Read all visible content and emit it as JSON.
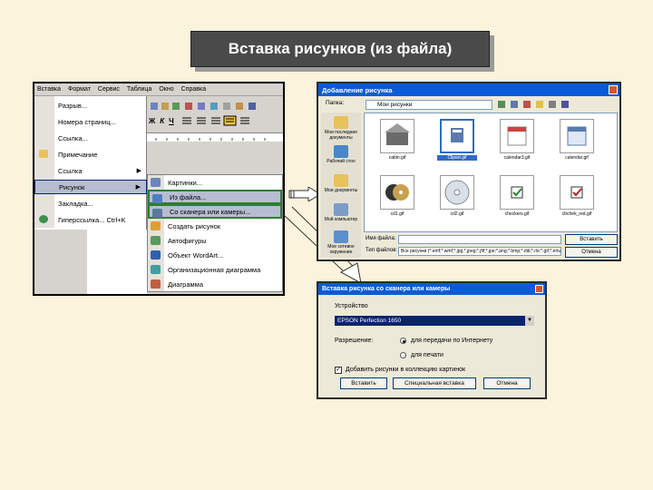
{
  "slide": {
    "title": "Вставка рисунков (из файла)"
  },
  "word": {
    "menubar": [
      "Вставка",
      "Формат",
      "Сервис",
      "Таблица",
      "Окно",
      "Справка"
    ],
    "insert_menu": [
      {
        "label": "Разрыв...",
        "icon": "none"
      },
      {
        "label": "Номера страниц...",
        "icon": "none"
      },
      {
        "label": "Ссылка...",
        "icon": "none"
      },
      {
        "label": "Примечание",
        "icon": "note-icon"
      },
      {
        "label": "Ссылка",
        "icon": "none",
        "submenu": true
      },
      {
        "label": "Рисунок",
        "icon": "none",
        "submenu": true,
        "highlighted": true
      },
      {
        "label": "Закладка...",
        "icon": "none"
      },
      {
        "label": "Гиперссылка...  Ctrl+K",
        "icon": "hyperlink-icon"
      }
    ],
    "expand_glyph": "»",
    "toolbar_row1": [
      "Ж",
      "К",
      "Ч"
    ],
    "picture_submenu": [
      {
        "label": "Картинки...",
        "icon": "clipart-icon"
      },
      {
        "label": "Из файла...",
        "icon": "from-file-icon",
        "boxed": true
      },
      {
        "label": "Со сканера или камеры...",
        "icon": "scanner-icon",
        "boxed": true
      },
      {
        "label": "Создать рисунок",
        "icon": "new-drawing-icon"
      },
      {
        "label": "Автофигуры",
        "icon": "autoshapes-icon"
      },
      {
        "label": "Объект WordArt...",
        "icon": "wordart-icon"
      },
      {
        "label": "Организационная диаграмма",
        "icon": "org-chart-icon"
      },
      {
        "label": "Диаграмма",
        "icon": "chart-icon"
      }
    ]
  },
  "insert_picture_dialog": {
    "title": "Добавление рисунка",
    "look_in_label": "Папка:",
    "look_in_value": "Мои рисунки",
    "places": [
      {
        "label": "Мои последние документы",
        "icon": "recent-docs-icon",
        "color": "#E8C25A"
      },
      {
        "label": "Рабочий стол",
        "icon": "desktop-icon",
        "color": "#4A86C8"
      },
      {
        "label": "Мои документы",
        "icon": "my-docs-icon",
        "color": "#E8C25A"
      },
      {
        "label": "Мой компьютер",
        "icon": "my-computer-icon",
        "color": "#7A9CC6"
      },
      {
        "label": "Мое сетевое окружение",
        "icon": "network-icon",
        "color": "#5A8FD0"
      }
    ],
    "files": [
      {
        "name": "cabin.gif",
        "icon": "cabin-thumb-icon"
      },
      {
        "name": "Clipart.gif",
        "icon": "clipart-thumb-icon",
        "selected": true
      },
      {
        "name": "calendar3.gif",
        "icon": "calendar-thumb-icon"
      },
      {
        "name": "calendar.gif",
        "icon": "calendar-thumb-icon"
      },
      {
        "name": "cd1.gif",
        "icon": "cd-thumb-icon"
      },
      {
        "name": "cd2.gif",
        "icon": "cd-thumb-icon"
      },
      {
        "name": "checkers.gif",
        "icon": "check-thumb-icon"
      },
      {
        "name": "cbchek_red.gif",
        "icon": "check-red-thumb-icon"
      }
    ],
    "filename_label": "Имя файла:",
    "filetype_label": "Тип файлов:",
    "filetype_value": "Все рисунки (*.emf;*.wmf;*.jpg;*.jpeg;*.jfif;*.jpe;*.png;*.bmp;*.dib;*.rle;*.gif;*.emz;*.wmz;*.pcz;*.tif;*.tiff)",
    "insert_button": "Вставить",
    "cancel_button": "Отмена",
    "accent": "#0A5BD8"
  },
  "scanner_dialog": {
    "title": "Вставка рисунка со сканера или камеры",
    "device_label": "Устройство",
    "device_value": "EPSON Perfection 1650",
    "resolution_label": "Разрешение:",
    "option_web": "для передачи по Интернету",
    "option_print": "для печати",
    "checkbox_label": "Добавить рисунки в коллекцию картинок",
    "insert_button": "Вставить",
    "custom_insert_button": "Специальная вставка",
    "cancel_button": "Отмена"
  },
  "colors": {
    "background": "#FBF3DC",
    "title_bg": "#4A4A4A",
    "highlight": "#B6BDD2",
    "boxed_border": "#2E7D32"
  }
}
